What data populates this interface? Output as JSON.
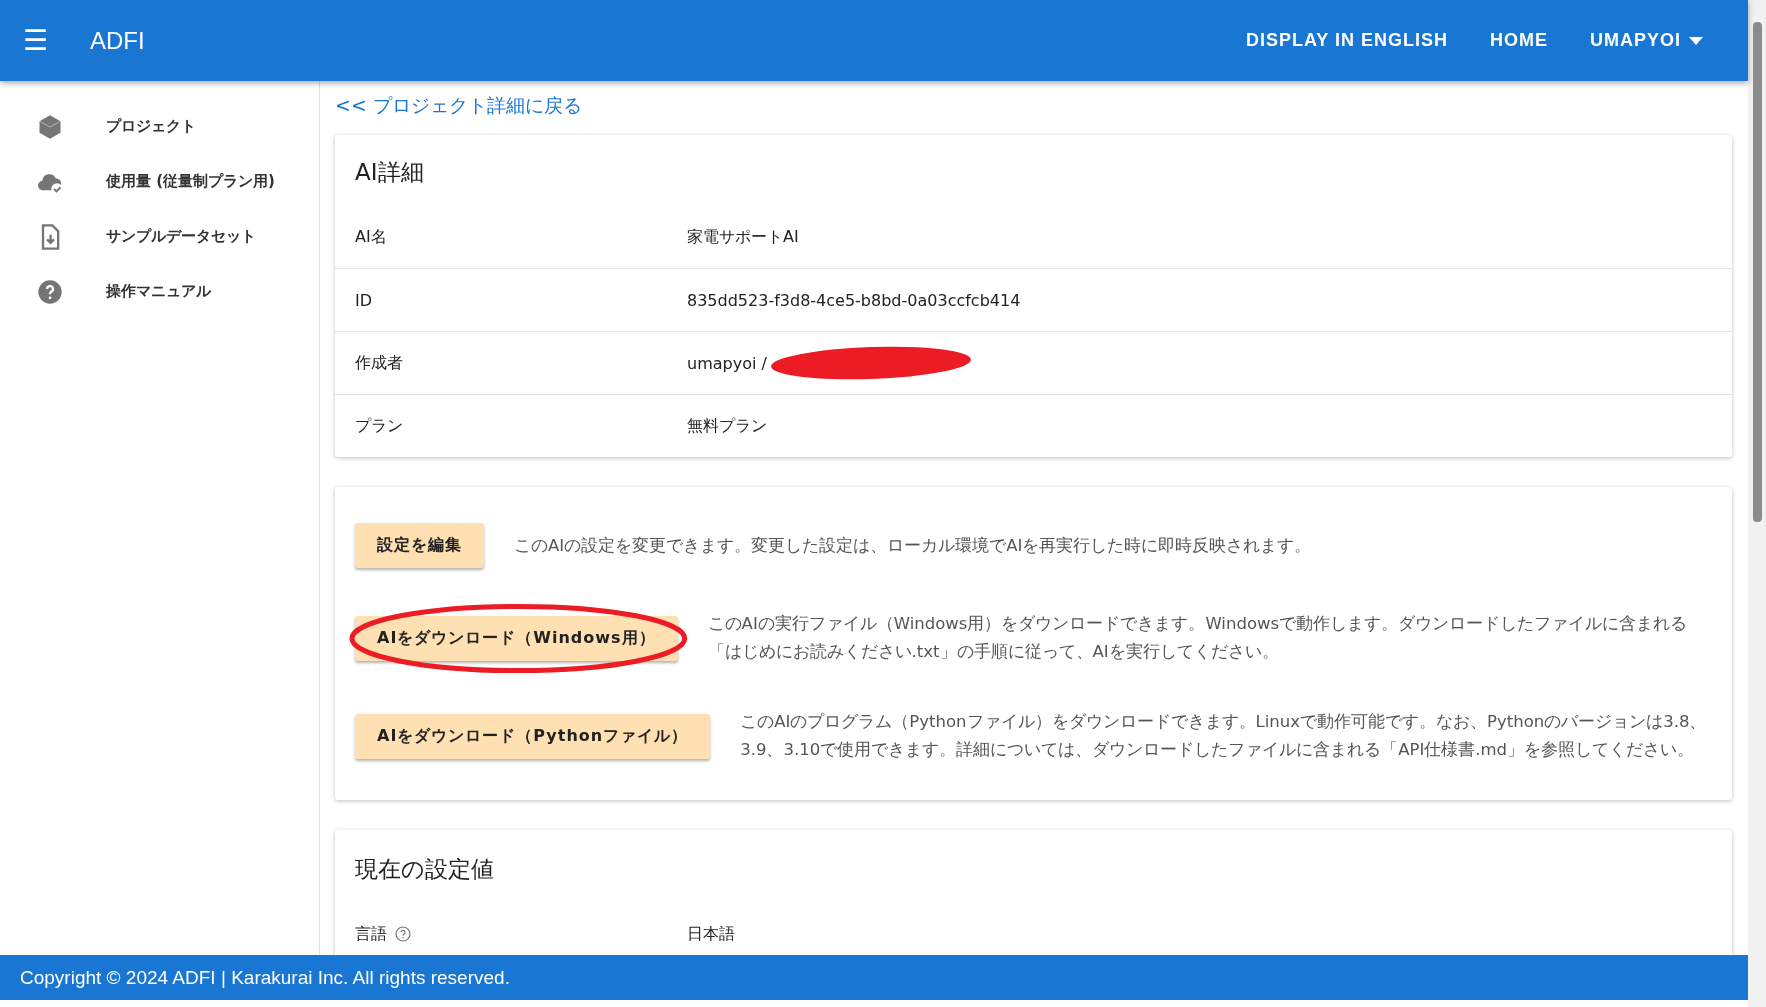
{
  "header": {
    "menu_icon": "☰",
    "title": "ADFI",
    "nav": [
      {
        "label": "DISPLAY IN ENGLISH",
        "kind": "link"
      },
      {
        "label": "HOME",
        "kind": "link"
      },
      {
        "label": "UMAPYOI",
        "kind": "dropdown"
      }
    ]
  },
  "sidebar": {
    "items": [
      {
        "label": "プロジェクト"
      },
      {
        "label": "使用量 (従量制プラン用)"
      },
      {
        "label": "サンプルデータセット"
      },
      {
        "label": "操作マニュアル"
      }
    ]
  },
  "back_link": "<< プロジェクト詳細に戻る",
  "details": {
    "title": "AI詳細",
    "rows": [
      {
        "label": "AI名",
        "value": "家電サポートAI",
        "redacted": false
      },
      {
        "label": "ID",
        "value": "835dd523-f3d8-4ce5-b8bd-0a03ccfcb414",
        "redacted": false
      },
      {
        "label": "作成者",
        "value": "umapyoi /",
        "redacted": true
      },
      {
        "label": "プラン",
        "value": "無料プラン",
        "redacted": false
      }
    ]
  },
  "actions": [
    {
      "button": "設定を編集",
      "description": "このAIの設定を変更できます。変更した設定は、ローカル環境でAIを再実行した時に即時反映されます。",
      "circled": false
    },
    {
      "button": "AIをダウンロード（Windows用）",
      "description": "このAIの実行ファイル（Windows用）をダウンロードできます。Windowsで動作します。ダウンロードしたファイルに含まれる「はじめにお読みください.txt」の手順に従って、AIを実行してください。",
      "circled": true
    },
    {
      "button": "AIをダウンロード（Pythonファイル）",
      "description": "このAIのプログラム（Pythonファイル）をダウンロードできます。Linuxで動作可能です。なお、Pythonのバージョンは3.8、3.9、3.10で使用できます。詳細については、ダウンロードしたファイルに含まれる「API仕様書.md」を参照してください。",
      "circled": false
    }
  ],
  "settings": {
    "title": "現在の設定値",
    "rows": [
      {
        "label": "言語",
        "value": "日本語",
        "help": true
      }
    ]
  },
  "footer": "Copyright © 2024 ADFI | Karakurai Inc. All rights reserved."
}
